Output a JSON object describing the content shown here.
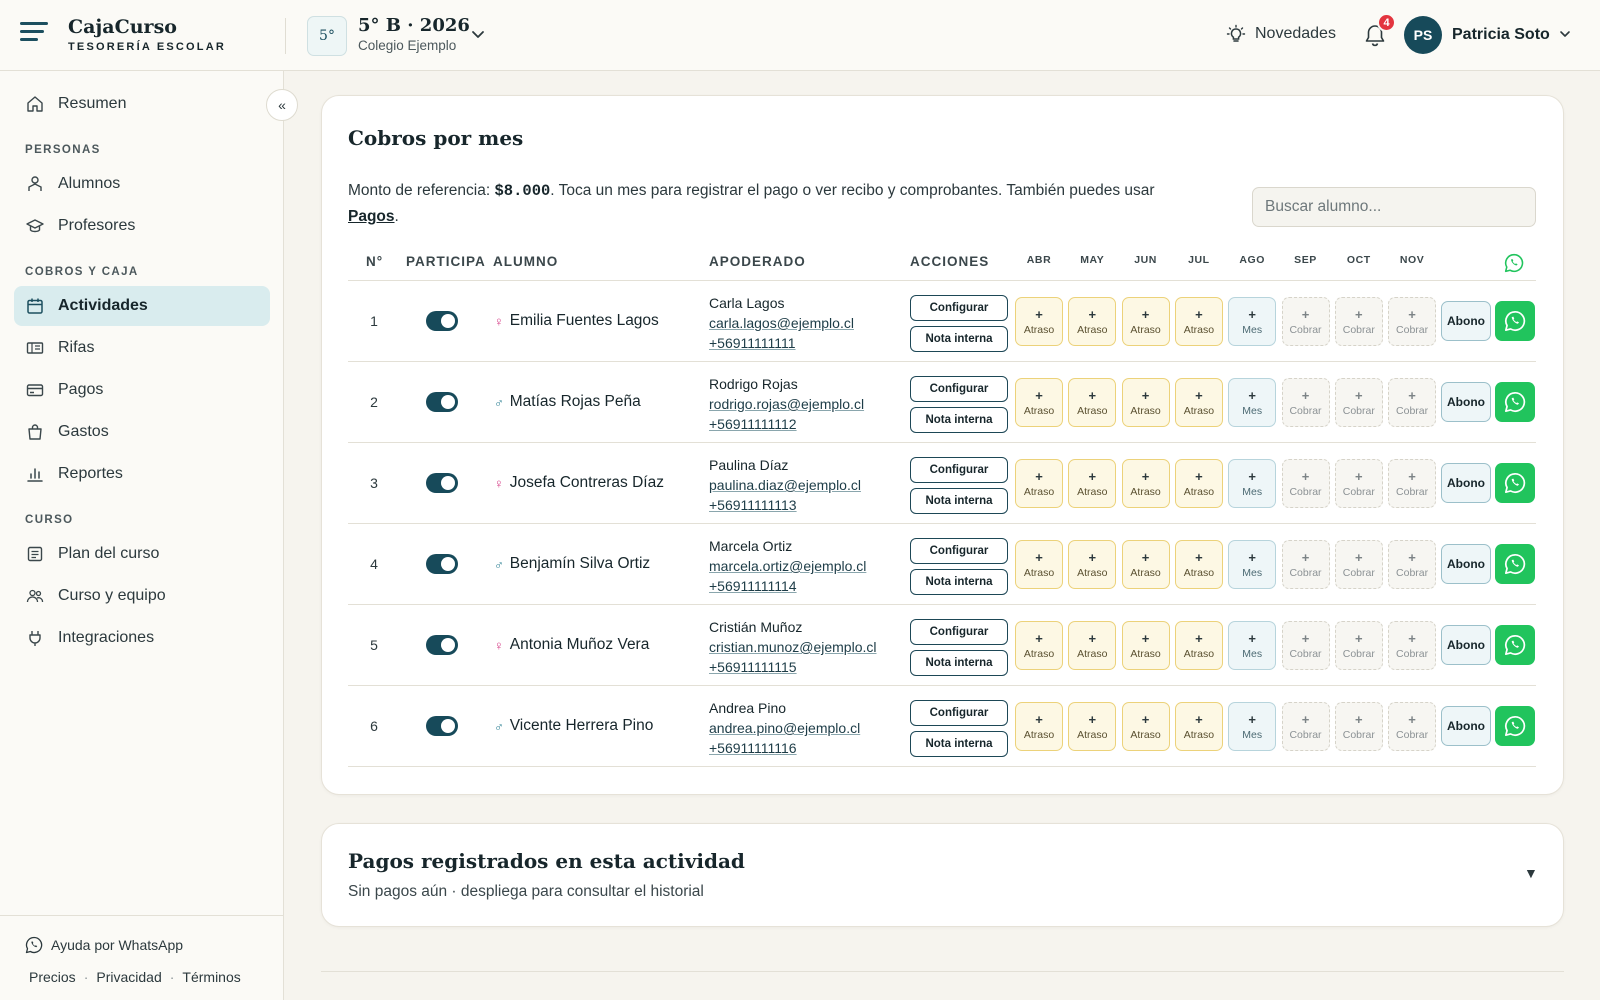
{
  "header": {
    "brand_name": "CajaCurso",
    "brand_sub": "TESORERÍA ESCOLAR",
    "course_badge": "5°",
    "course_title": "5° B · 2026",
    "course_school": "Colegio Ejemplo",
    "news_label": "Novedades",
    "notification_count": "4",
    "user_initials": "PS",
    "user_name": "Patricia Soto"
  },
  "sidebar": {
    "collapse_icon": "«",
    "top_item": "Resumen",
    "sections": [
      {
        "title": "PERSONAS",
        "items": [
          "Alumnos",
          "Profesores"
        ]
      },
      {
        "title": "COBROS Y CAJA",
        "items": [
          "Actividades",
          "Rifas",
          "Pagos",
          "Gastos",
          "Reportes"
        ]
      },
      {
        "title": "CURSO",
        "items": [
          "Plan del curso",
          "Curso y equipo",
          "Integraciones"
        ]
      }
    ],
    "active_item": "Actividades",
    "help_label": "Ayuda por WhatsApp",
    "footer_links": [
      "Precios",
      "Privacidad",
      "Términos"
    ],
    "footer_sep": "·"
  },
  "main": {
    "title": "Cobros por mes",
    "desc_prefix": "Monto de referencia: ",
    "desc_amount": "$8.000",
    "desc_middle": ". Toca un mes para registrar el pago o ver recibo y comprobantes. También puedes usar ",
    "desc_link": "Pagos",
    "desc_suffix": ".",
    "search_placeholder": "Buscar alumno...",
    "columns": {
      "num": "N°",
      "participa": "PARTICIPA",
      "alumno": "ALUMNO",
      "apoderado": "APODERADO",
      "acciones": "ACCIONES"
    },
    "months": [
      "ABR",
      "MAY",
      "JUN",
      "JUL",
      "AGO",
      "SEP",
      "OCT",
      "NOV"
    ],
    "month_states": [
      "late",
      "late",
      "late",
      "late",
      "cur",
      "due",
      "due",
      "due"
    ],
    "state_labels": {
      "late": "Atraso",
      "cur": "Mes",
      "due": "Cobrar"
    },
    "plus_symbol": "+",
    "configure_label": "Configurar",
    "note_label": "Nota interna",
    "abono_label": "Abono",
    "rows": [
      {
        "num": "1",
        "gender": "f",
        "gender_symbol": "♀",
        "student": "Emilia Fuentes Lagos",
        "guardian": "Carla Lagos",
        "email": "carla.lagos@ejemplo.cl",
        "phone": "+56911111111",
        "participa": true
      },
      {
        "num": "2",
        "gender": "m",
        "gender_symbol": "♂",
        "student": "Matías Rojas Peña",
        "guardian": "Rodrigo Rojas",
        "email": "rodrigo.rojas@ejemplo.cl",
        "phone": "+56911111112",
        "participa": true
      },
      {
        "num": "3",
        "gender": "f",
        "gender_symbol": "♀",
        "student": "Josefa Contreras Díaz",
        "guardian": "Paulina Díaz",
        "email": "paulina.diaz@ejemplo.cl",
        "phone": "+56911111113",
        "participa": true
      },
      {
        "num": "4",
        "gender": "m",
        "gender_symbol": "♂",
        "student": "Benjamín Silva Ortiz",
        "guardian": "Marcela Ortiz",
        "email": "marcela.ortiz@ejemplo.cl",
        "phone": "+56911111114",
        "participa": true
      },
      {
        "num": "5",
        "gender": "f",
        "gender_symbol": "♀",
        "student": "Antonia Muñoz Vera",
        "guardian": "Cristián Muñoz",
        "email": "cristian.munoz@ejemplo.cl",
        "phone": "+56911111115",
        "participa": true
      },
      {
        "num": "6",
        "gender": "m",
        "gender_symbol": "♂",
        "student": "Vicente Herrera Pino",
        "guardian": "Andrea Pino",
        "email": "andrea.pino@ejemplo.cl",
        "phone": "+56911111116",
        "participa": true
      }
    ]
  },
  "payments": {
    "title": "Pagos registrados en esta actividad",
    "subtitle": "Sin pagos aún · despliega para consultar el historial",
    "toggle_symbol": "▼"
  },
  "colors": {
    "accent": "#174a5a",
    "active_nav": "#d9ecee",
    "whatsapp": "#21c45d",
    "late_border": "#ecd27a",
    "late_bg": "#fdf8e4",
    "notification": "#e3353f"
  }
}
